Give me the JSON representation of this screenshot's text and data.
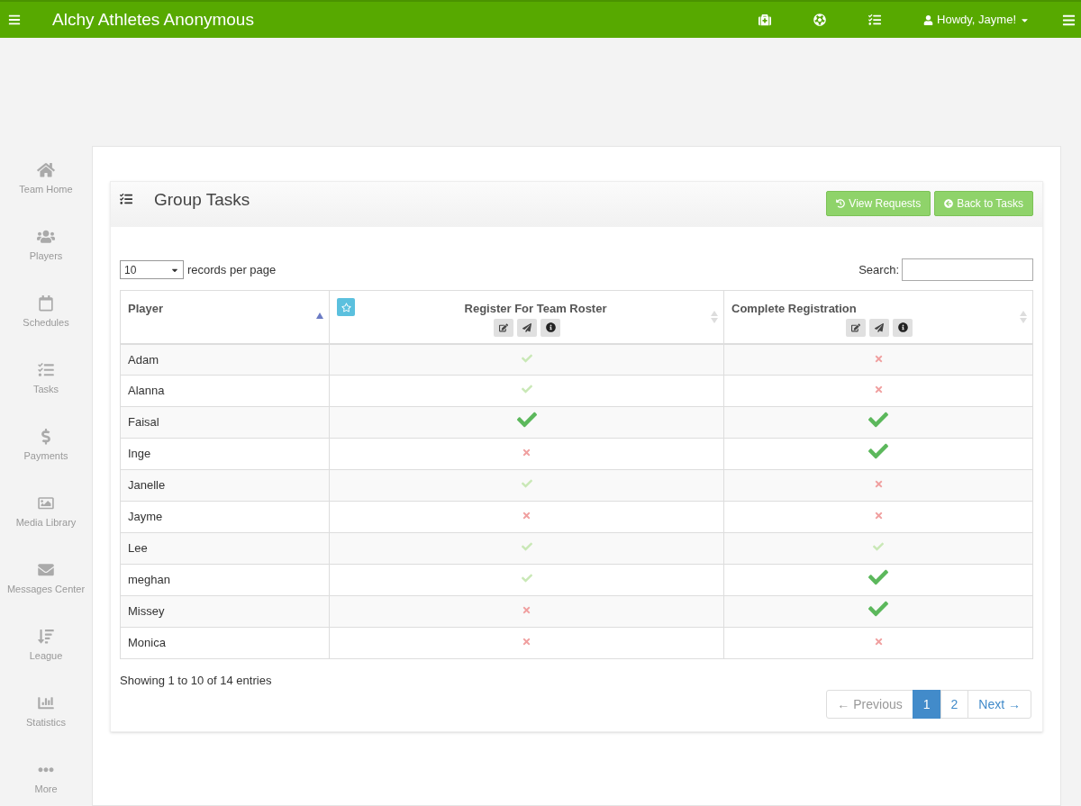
{
  "navbar": {
    "brand": "Alchy Athletes Anonymous",
    "user": "Howdy, Jayme!"
  },
  "sidebar": {
    "items": [
      {
        "label": "Team Home"
      },
      {
        "label": "Players"
      },
      {
        "label": "Schedules"
      },
      {
        "label": "Tasks"
      },
      {
        "label": "Payments"
      },
      {
        "label": "Media Library"
      },
      {
        "label": "Messages Center"
      },
      {
        "label": "League"
      },
      {
        "label": "Statistics"
      },
      {
        "label": "More"
      }
    ]
  },
  "panel": {
    "title": "Group Tasks",
    "buttons": [
      {
        "label": "View Requests"
      },
      {
        "label": "Back to Tasks"
      }
    ]
  },
  "length_menu": {
    "value": "10",
    "label": "records per page"
  },
  "search": {
    "label": "Search:"
  },
  "table": {
    "columns": [
      {
        "label": "Player",
        "sorted": true,
        "tools": false,
        "star": false
      },
      {
        "label": "Register For Team Roster",
        "sorted": false,
        "tools": true,
        "star": true
      },
      {
        "label": "Complete Registration",
        "sorted": false,
        "tools": true,
        "star": false
      }
    ],
    "rows": [
      {
        "player": "Adam",
        "cells": [
          {
            "checked": true,
            "approved": false
          },
          {
            "checked": false,
            "approved": false
          }
        ]
      },
      {
        "player": "Alanna",
        "cells": [
          {
            "checked": true,
            "approved": false
          },
          {
            "checked": false,
            "approved": false
          }
        ]
      },
      {
        "player": "Faisal",
        "cells": [
          {
            "checked": true,
            "approved": true
          },
          {
            "checked": true,
            "approved": true
          }
        ]
      },
      {
        "player": "Inge",
        "cells": [
          {
            "checked": false,
            "approved": false
          },
          {
            "checked": true,
            "approved": true
          }
        ]
      },
      {
        "player": "Janelle",
        "cells": [
          {
            "checked": true,
            "approved": false
          },
          {
            "checked": false,
            "approved": false
          }
        ]
      },
      {
        "player": "Jayme",
        "cells": [
          {
            "checked": false,
            "approved": false
          },
          {
            "checked": false,
            "approved": false
          }
        ]
      },
      {
        "player": "Lee",
        "cells": [
          {
            "checked": true,
            "approved": false
          },
          {
            "checked": true,
            "approved": false
          }
        ]
      },
      {
        "player": "meghan",
        "cells": [
          {
            "checked": true,
            "approved": false
          },
          {
            "checked": true,
            "approved": true
          }
        ]
      },
      {
        "player": "Missey",
        "cells": [
          {
            "checked": false,
            "approved": false
          },
          {
            "checked": true,
            "approved": true
          }
        ]
      },
      {
        "player": "Monica",
        "cells": [
          {
            "checked": false,
            "approved": false
          },
          {
            "checked": false,
            "approved": false
          }
        ]
      }
    ]
  },
  "info": "Showing 1 to 10 of 14 entries",
  "pagination": [
    {
      "label": "← Previous",
      "selected": false,
      "disabled": true
    },
    {
      "label": "1",
      "selected": true,
      "disabled": false
    },
    {
      "label": "2",
      "selected": false,
      "disabled": false
    },
    {
      "label": "Next →",
      "selected": false,
      "disabled": false
    }
  ]
}
